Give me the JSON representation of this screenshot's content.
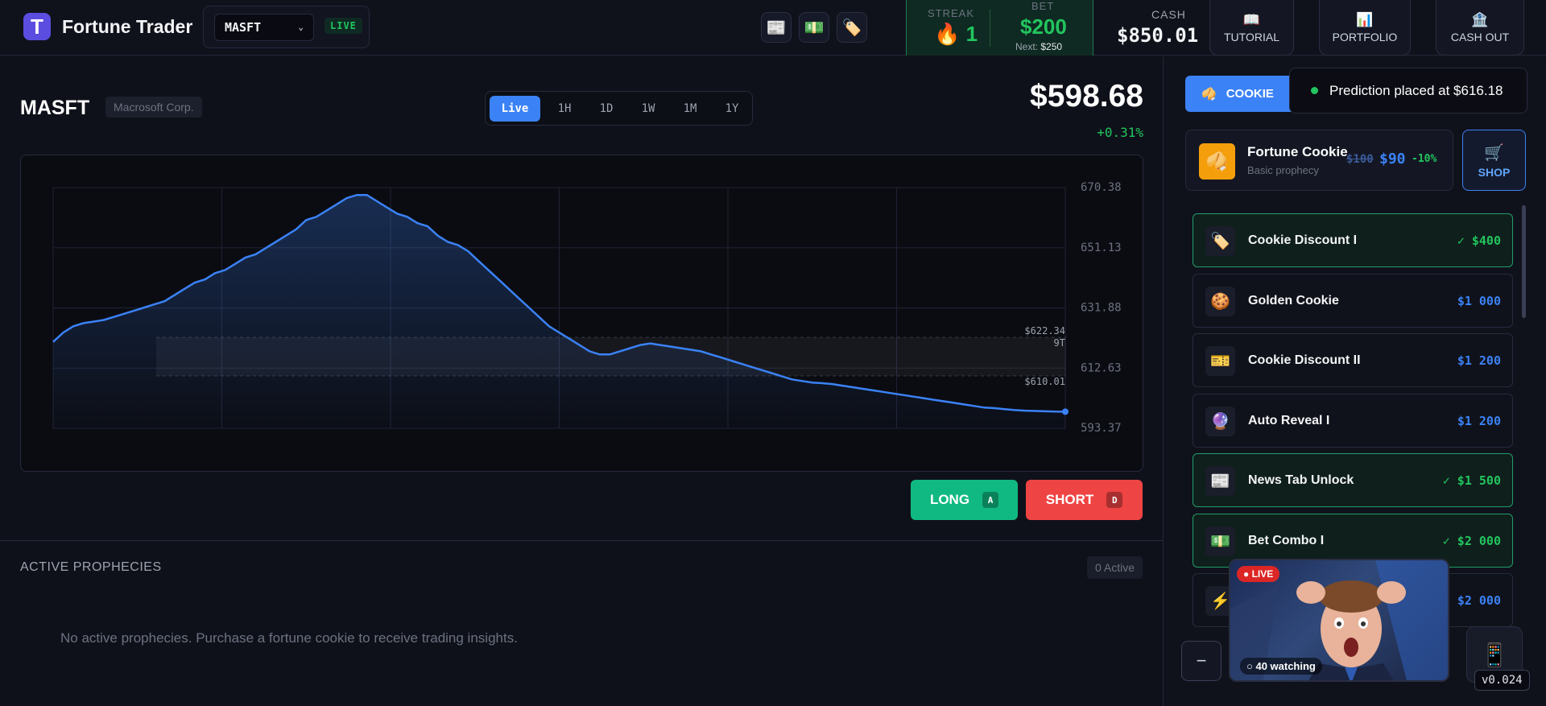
{
  "header": {
    "logo_letter": "T",
    "app_title": "Fortune Trader",
    "ticker": "MASFT",
    "live_label": "LIVE",
    "tools": [
      {
        "icon": "newspaper-icon",
        "glyph": "📰"
      },
      {
        "icon": "money-icon",
        "glyph": "💵"
      },
      {
        "icon": "tag-icon",
        "glyph": "🏷️"
      }
    ],
    "streak_label": "STREAK",
    "streak_value": "🔥 1",
    "bet_label": "BET",
    "bet_value": "$200",
    "bet_next_label": "Next:",
    "bet_next_value": "$250",
    "cash_label": "CASH",
    "cash_value": "$850.01",
    "nav": [
      {
        "label": "TUTORIAL",
        "icon": "book-icon",
        "glyph": "📖"
      },
      {
        "label": "PORTFOLIO",
        "icon": "bar-chart-icon",
        "glyph": "📊"
      },
      {
        "label": "CASH OUT",
        "icon": "bank-icon",
        "glyph": "🏦"
      }
    ]
  },
  "main": {
    "symbol": "MASFT",
    "company": "Macrosoft Corp.",
    "timeframes": [
      "Live",
      "1H",
      "1D",
      "1W",
      "1M",
      "1Y"
    ],
    "active_timeframe": "Live",
    "price": "$598.68",
    "change": "+0.31%",
    "long_label": "LONG",
    "long_key": "A",
    "short_label": "SHORT",
    "short_key": "D",
    "prophecies_title": "ACTIVE PROPHECIES",
    "prophecies_count": "0 Active",
    "prophecies_empty": "No active prophecies. Purchase a fortune cookie to receive trading insights."
  },
  "chart_data": {
    "type": "area",
    "ylim": [
      593.37,
      670.38
    ],
    "yticks": [
      "670.38",
      "651.13",
      "631.88",
      "612.63",
      "593.37"
    ],
    "band_high": "$622.34",
    "band_high_marker": "9T",
    "band_low": "$610.01",
    "values": [
      621,
      624,
      626,
      627,
      627.5,
      628,
      629,
      630,
      631,
      632,
      633,
      634,
      636,
      638,
      640,
      641,
      643,
      644,
      646,
      648,
      649,
      651,
      653,
      655,
      657,
      660,
      661,
      663,
      665,
      667,
      668,
      668,
      666,
      664,
      662,
      661,
      659,
      658,
      655,
      653,
      652,
      650,
      647,
      644,
      641,
      638,
      635,
      632,
      629,
      626,
      624,
      622,
      620,
      618,
      617,
      617,
      618,
      619,
      620,
      620.5,
      620,
      619.5,
      619,
      618.5,
      618,
      617,
      616,
      615,
      614,
      613,
      612,
      611,
      610,
      609,
      608.5,
      608,
      607.8,
      607.5,
      607,
      606.5,
      606,
      605.5,
      605,
      604.5,
      604,
      603.5,
      603,
      602.5,
      602,
      601.5,
      601,
      600.5,
      600,
      599.8,
      599.5,
      599.2,
      599,
      598.9,
      598.8,
      598.7,
      598.68
    ],
    "point_count": 100,
    "color": "#3b82f6"
  },
  "sidebar": {
    "tab_label": "COOKIE",
    "toast": "Prediction placed at $616.18",
    "fortune": {
      "title": "Fortune Cookie",
      "subtitle": "Basic prophecy",
      "old_price": "$100",
      "new_price": "$90",
      "discount": "-10%"
    },
    "shop_label": "SHOP",
    "items": [
      {
        "name": "Cookie Discount I",
        "price": "✓ $400",
        "owned": true,
        "icon": "tag-icon",
        "glyph": "🏷️"
      },
      {
        "name": "Golden Cookie",
        "price": "$1 000",
        "owned": false,
        "icon": "cookie-icon",
        "glyph": "🍪"
      },
      {
        "name": "Cookie Discount II",
        "price": "$1 200",
        "owned": false,
        "icon": "ticket-icon",
        "glyph": "🎫"
      },
      {
        "name": "Auto Reveal I",
        "price": "$1 200",
        "owned": false,
        "icon": "crystal-ball-icon",
        "glyph": "🔮"
      },
      {
        "name": "News Tab Unlock",
        "price": "✓ $1 500",
        "owned": true,
        "icon": "newspaper-icon",
        "glyph": "📰"
      },
      {
        "name": "Bet Combo I",
        "price": "✓ $2 000",
        "owned": true,
        "icon": "money-icon",
        "glyph": "💵"
      },
      {
        "name": "",
        "price": "$2 000",
        "owned": false,
        "icon": "lightning-icon",
        "glyph": "⚡"
      }
    ],
    "stream_live": "● LIVE",
    "stream_watching": "○ 40 watching",
    "collapse_label": "−",
    "version": "v0.024"
  }
}
